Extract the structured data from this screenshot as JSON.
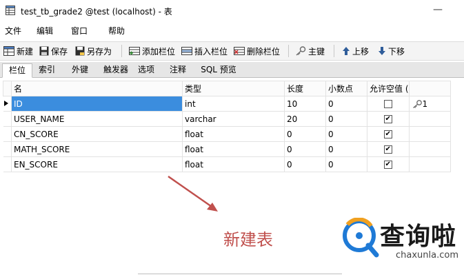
{
  "window": {
    "title": "test_tb_grade2 @test (localhost) - 表",
    "minimize_glyph": "—"
  },
  "menu": [
    "文件",
    "编辑",
    "窗口",
    "帮助"
  ],
  "toolbar": {
    "new": "新建",
    "save": "保存",
    "save_as": "另存为",
    "add_field": "添加栏位",
    "insert_field": "插入栏位",
    "delete_field": "删除栏位",
    "primary_key": "主键",
    "move_up": "上移",
    "move_down": "下移"
  },
  "tabs": [
    "栏位",
    "索引",
    "外键",
    "触发器",
    "选项",
    "注释",
    "SQL 预览"
  ],
  "grid": {
    "headers": [
      "名",
      "类型",
      "长度",
      "小数点",
      "允许空值 ("
    ],
    "rows": [
      {
        "name": "ID",
        "type": "int",
        "length": "10",
        "decimals": "0",
        "allow_null": false,
        "key": "1"
      },
      {
        "name": "USER_NAME",
        "type": "varchar",
        "length": "20",
        "decimals": "0",
        "allow_null": true,
        "key": ""
      },
      {
        "name": "CN_SCORE",
        "type": "float",
        "length": "0",
        "decimals": "0",
        "allow_null": true,
        "key": ""
      },
      {
        "name": "MATH_SCORE",
        "type": "float",
        "length": "0",
        "decimals": "0",
        "allow_null": true,
        "key": ""
      },
      {
        "name": "EN_SCORE",
        "type": "float",
        "length": "0",
        "decimals": "0",
        "allow_null": true,
        "key": ""
      }
    ]
  },
  "annotation": {
    "caption": "新建表",
    "color": "#c0504d"
  },
  "watermark": {
    "cn": "查询啦",
    "en": "chaxunla.com"
  },
  "colors": {
    "selection": "#3b8dde",
    "toolbar_bg": "#f4f4f4"
  }
}
